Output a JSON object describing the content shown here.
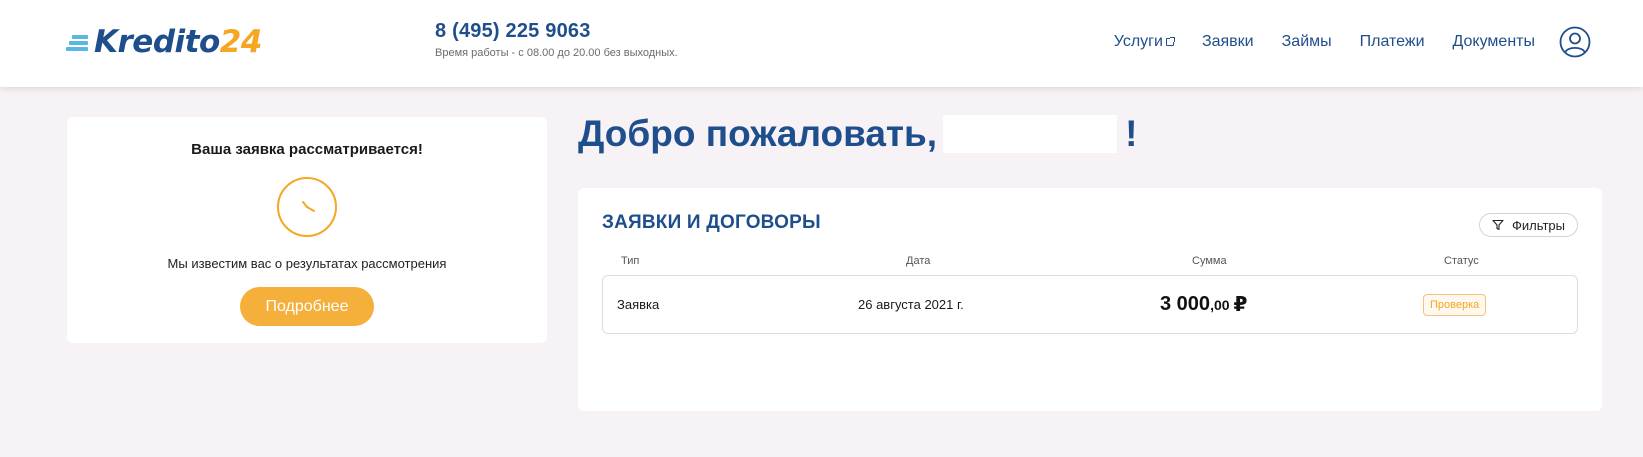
{
  "header": {
    "logo": {
      "part1": "Kredito",
      "part2": "24"
    },
    "phone": "8 (495) 225 9063",
    "hours": "Время работы - с 08.00 до 20.00 без выходных.",
    "nav": [
      {
        "label": "Услуги",
        "external": true
      },
      {
        "label": "Заявки"
      },
      {
        "label": "Займы"
      },
      {
        "label": "Платежи"
      },
      {
        "label": "Документы"
      }
    ],
    "user_icon": "user-circle-icon"
  },
  "status_card": {
    "title": "Ваша заявка рассматривается!",
    "icon": "clock-icon",
    "subtitle": "Мы известим вас о результатах рассмотрения",
    "button_label": "Подробнее"
  },
  "welcome": {
    "prefix": "Добро пожаловать,",
    "suffix": "!"
  },
  "applications": {
    "title": "ЗАЯВКИ И ДОГОВОРЫ",
    "filter_label": "Фильтры",
    "filter_icon": "filter-icon",
    "columns": [
      "Тип",
      "Дата",
      "Сумма",
      "Статус"
    ],
    "rows": [
      {
        "type": "Заявка",
        "date": "26 августа 2021 г.",
        "amount_main": "3 000",
        "amount_decimal": ",00",
        "currency": "₽",
        "status": "Проверка"
      }
    ]
  },
  "colors": {
    "brand_blue": "#1f4e8c",
    "brand_orange": "#f5a623",
    "button_orange": "#f5b03b",
    "logo_stripes": "#58b7e3",
    "page_bg": "#f6f2f6"
  }
}
